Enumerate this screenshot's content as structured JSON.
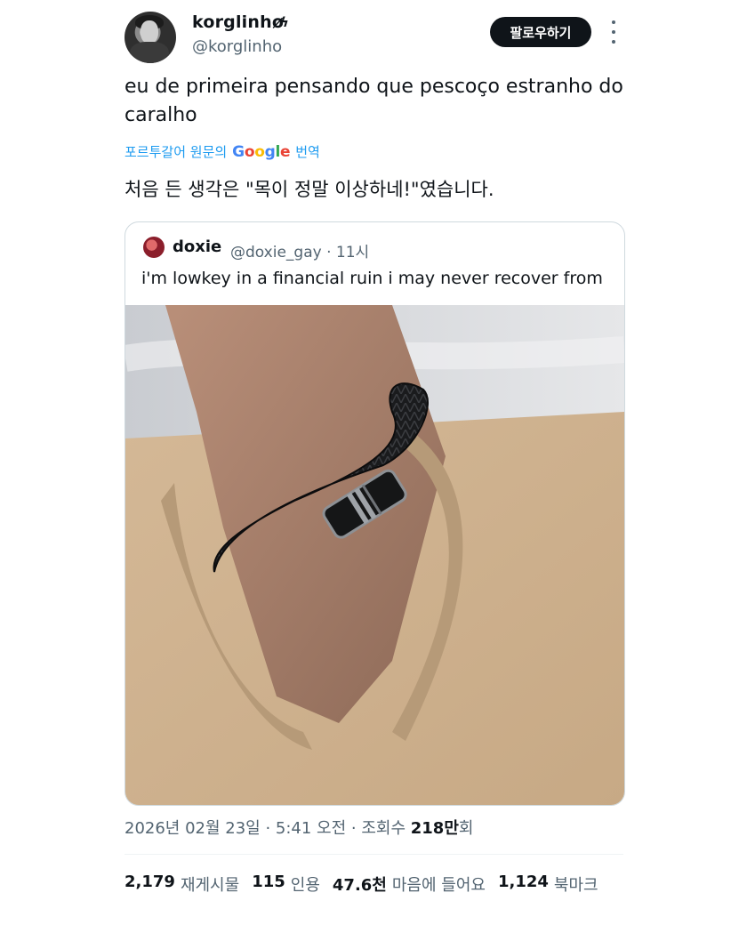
{
  "author": {
    "name": "korglinhø",
    "badge": "ϟ",
    "handle": "@korglinho"
  },
  "follow_label": "팔로우하기",
  "tweet_text": "eu de primeira pensando que pescoço estranho do caralho",
  "translate": {
    "prefix": "포르투갈어 원문의",
    "google": [
      "G",
      "o",
      "o",
      "g",
      "l",
      "e"
    ],
    "suffix": "번역"
  },
  "translated_text": "처음 든 생각은 \"목이 정말 이상하네!\"였습니다.",
  "quote": {
    "name": "doxie",
    "handle_time": "@doxie_gay · 11시",
    "text": "i'm lowkey in a financial ruin i may never recover from"
  },
  "timestamp": {
    "date_time": "2026년 02월 23일 · 5:41 오전 · 조회수",
    "views_num": "218만",
    "views_unit": "회"
  },
  "stats": [
    {
      "num": "2,179",
      "label": "재게시물"
    },
    {
      "num": "115",
      "label": "인용"
    },
    {
      "num": "47.6천",
      "label": "마음에 들어요"
    },
    {
      "num": "1,124",
      "label": "북마크"
    }
  ],
  "colors": {
    "accent": "#1d9bf0",
    "text": "#0f1419",
    "muted": "#536471",
    "border": "#cfd9de"
  }
}
